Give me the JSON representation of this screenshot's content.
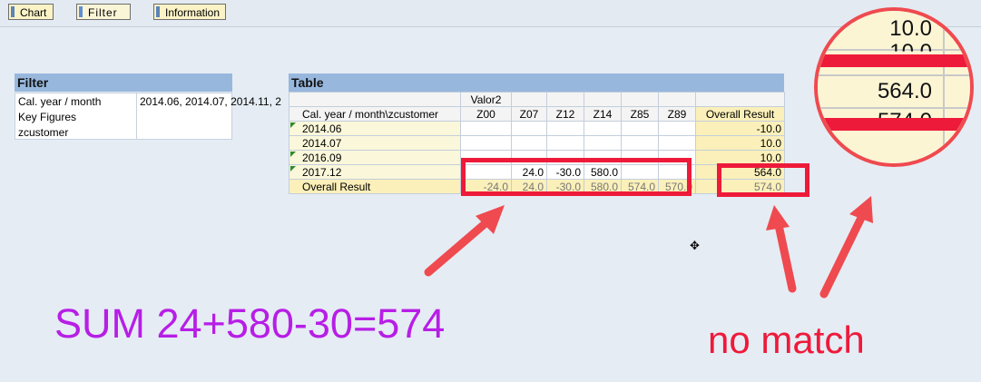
{
  "tabs": [
    "Chart",
    "Filter",
    "Information"
  ],
  "filter": {
    "title": "Filter",
    "labels": [
      "Cal. year / month",
      "Key Figures",
      "zcustomer"
    ],
    "value": "2014.06, 2014.07, 2014.11, 2"
  },
  "table": {
    "title": "Table",
    "group_header": "Valor2",
    "row_dim_label": "Cal. year / month\\zcustomer",
    "columns": [
      "Z00",
      "Z07",
      "Z12",
      "Z14",
      "Z85",
      "Z89",
      "Overall Result"
    ],
    "rows": [
      {
        "label": "2014.06",
        "cells": [
          "",
          "",
          "",
          "",
          "",
          "",
          "-10.0"
        ]
      },
      {
        "label": "2014.07",
        "cells": [
          "",
          "",
          "",
          "",
          "",
          "",
          "10.0"
        ]
      },
      {
        "label": "2016.09",
        "cells": [
          "",
          "",
          "",
          "",
          "",
          "",
          "10.0"
        ]
      },
      {
        "label": "2017.12",
        "cells": [
          "",
          "24.0",
          "-30.0",
          "580.0",
          "",
          "",
          "564.0"
        ]
      }
    ],
    "total_row": {
      "label": "Overall Result",
      "cells": [
        "-24.0",
        "24.0",
        "-30.0",
        "580.0",
        "574.0",
        "570.0",
        "574.0"
      ]
    }
  },
  "zoom": {
    "values": [
      "10.0",
      "10.0",
      "564.0",
      "574.0"
    ]
  },
  "annotations": {
    "sum_text": "SUM 24+580-30=574",
    "no_match_text": "no match",
    "colors": {
      "sum": "#b71ee6",
      "red": "#ee1a3a"
    }
  }
}
